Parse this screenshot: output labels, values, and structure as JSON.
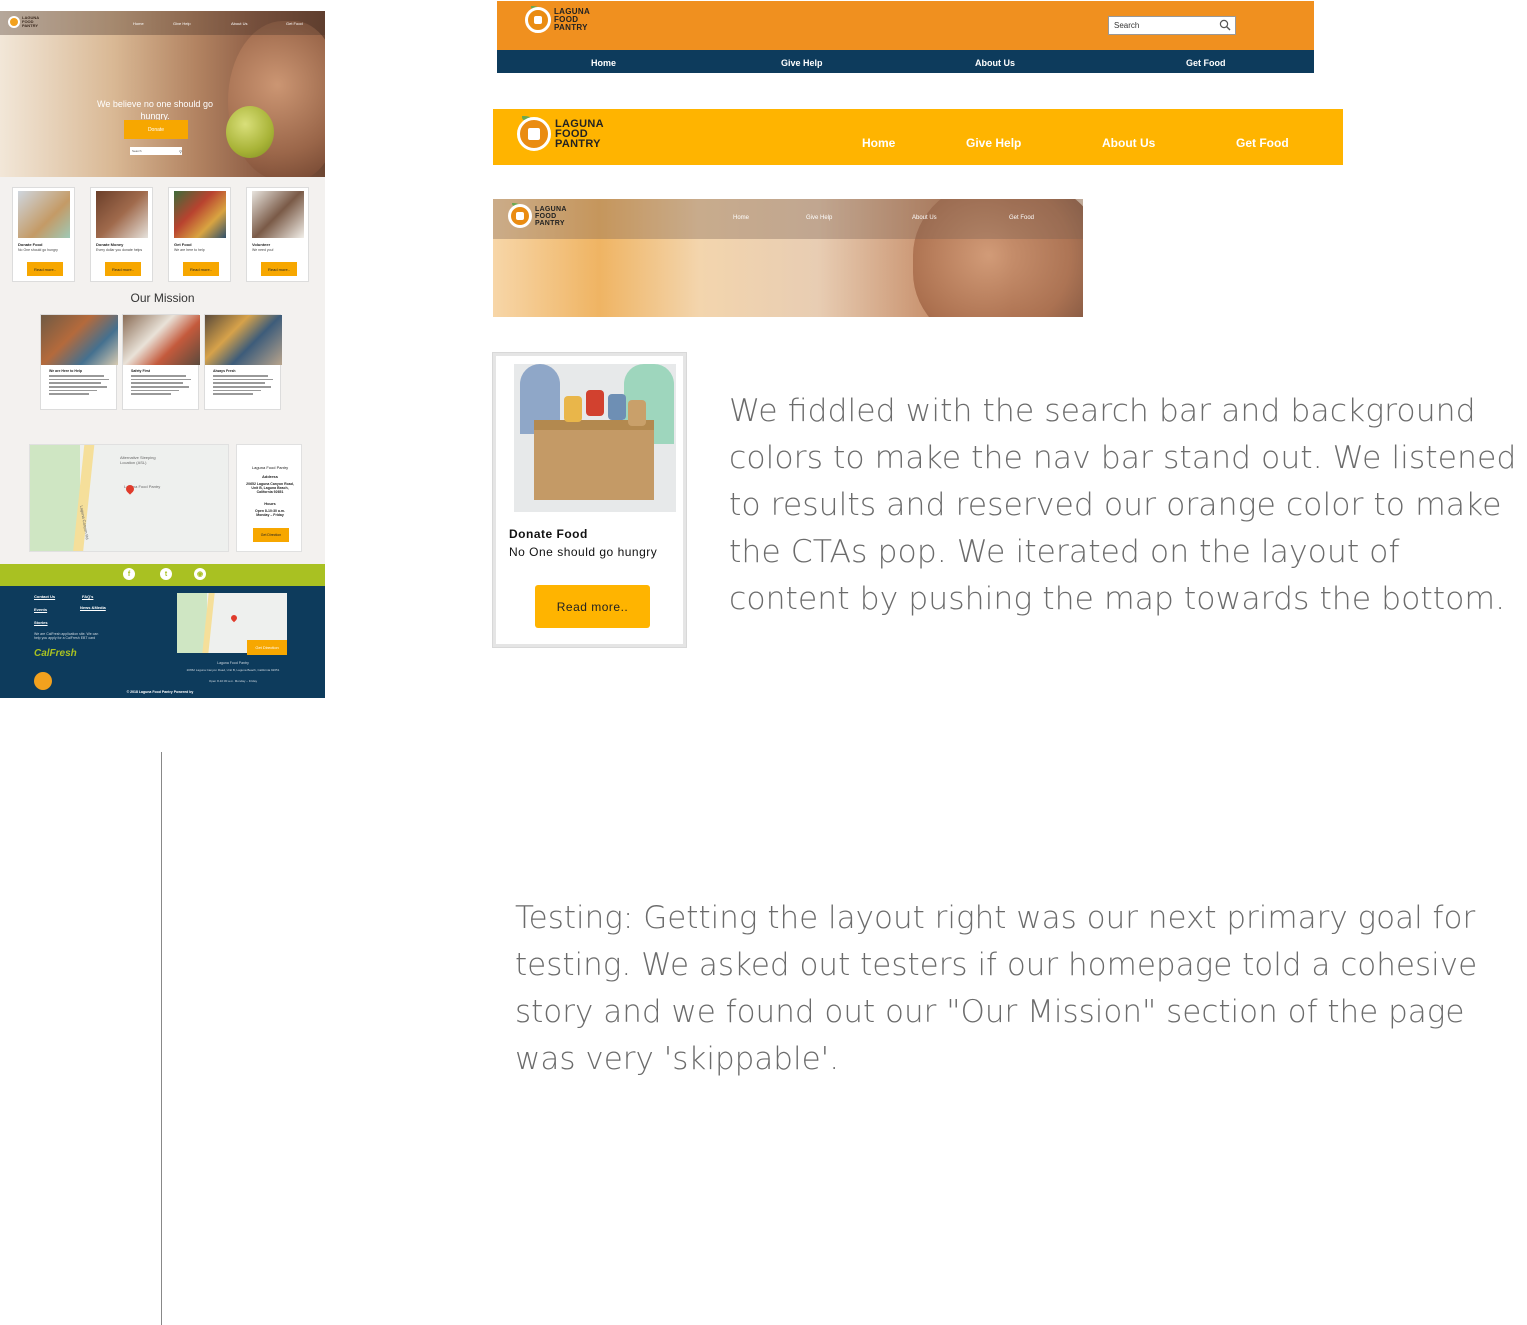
{
  "mockup": {
    "logo_text": [
      "LAGUNA",
      "FOOD",
      "PANTRY"
    ],
    "nav": [
      "Home",
      "Give Help",
      "About Us",
      "Get Food"
    ],
    "hero_headline": "We believe no one should go hungry.",
    "donate_button": "Donate",
    "search_placeholder": "Search",
    "cards": [
      {
        "title": "Donate Food",
        "text": "No One should go hungry",
        "button": "Read more.."
      },
      {
        "title": "Donate Money",
        "text": "Every dollar you donate helps",
        "button": "Read more.."
      },
      {
        "title": "Get Food",
        "text": "We are here to help",
        "button": "Read more.."
      },
      {
        "title": "Volunteer",
        "text": "We need you!",
        "button": "Read more.."
      }
    ],
    "mission_heading": "Our Mission",
    "mission_cards": [
      {
        "title": "We are Here to Help"
      },
      {
        "title": "Safety First"
      },
      {
        "title": "Always Fresh"
      }
    ],
    "map_labels": {
      "location1": "Alternative Sleeping Location (ASL)",
      "location2": "Laguna Food Pantry",
      "road": "Laguna Canyon Rd"
    },
    "info": {
      "name": "Laguna Food Pantry",
      "address_label": "Address",
      "address": "20652 Laguna Canyon Road, Unit B, Laguna Beach, California 92651",
      "hours_label": "Hours",
      "hours": "Open 8-10:30 a.m. Monday – Friday",
      "button": "Get Direction"
    },
    "footer": {
      "links": [
        "Contact Us",
        "FAQ's",
        "Events",
        "News &Media",
        "Stories"
      ],
      "calfresh_note": "We are CalFresh application site. We can help you apply for a CalFresh EBT card",
      "calfresh_logo": "CalFresh",
      "direction_button": "Get Direction",
      "address_title": "Laguna Food Pantry",
      "address": "20652 Laguna Canyon Road, Unit B, Laguna Beach, California 92651",
      "hours": "Open 8-10:30 a.m. Monday – Friday",
      "copyright": "© 2018 Laguna Food Pantry Powered by"
    },
    "social_icons": [
      "facebook-icon",
      "twitter-icon",
      "instagram-icon"
    ]
  },
  "nav_v1": {
    "logo_text": [
      "LAGUNA",
      "FOOD",
      "PANTRY"
    ],
    "search_placeholder": "Search",
    "items": [
      "Home",
      "Give Help",
      "About Us",
      "Get Food"
    ],
    "colors": {
      "top": "#f0901f",
      "bottom": "#0d3b5c"
    }
  },
  "nav_v2": {
    "logo_text": [
      "LAGUNA",
      "FOOD",
      "PANTRY"
    ],
    "items": [
      "Home",
      "Give Help",
      "About Us",
      "Get Food"
    ],
    "colors": {
      "background": "#ffb400"
    }
  },
  "nav_v3": {
    "logo_text": [
      "LAGUNA",
      "FOOD",
      "PANTRY"
    ],
    "items": [
      "Home",
      "Give Help",
      "About Us",
      "Get Food"
    ]
  },
  "card_zoom": {
    "title": "Donate Food",
    "text": "No One should go hungry",
    "button": "Read more.."
  },
  "paragraph1": "We fiddled with the search bar and background colors to make the nav bar stand out. We listened to results and reserved our orange color to make the CTAs pop. We iterated on the layout of content by pushing the map towards the bottom.",
  "paragraph2": "Testing: Getting the layout right was our next primary goal for testing. We asked out testers if our homepage told a cohesive story and we found out our \"Our Mission\" section of the page was very 'skippable'."
}
